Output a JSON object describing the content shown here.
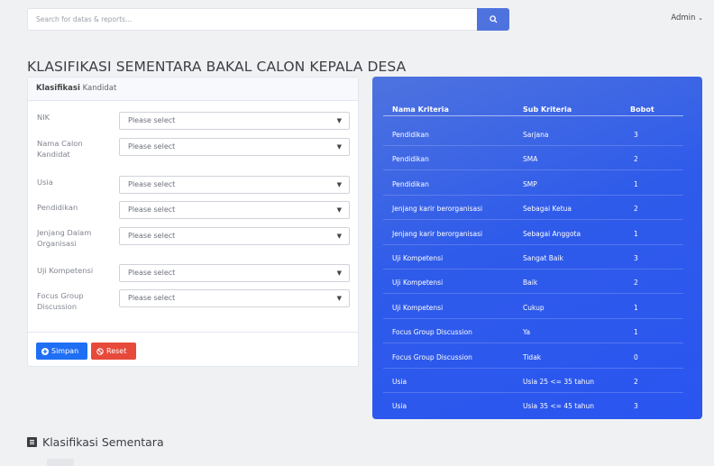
{
  "search": {
    "placeholder": "Search for datas & reports..."
  },
  "user": {
    "name": "Admin",
    "caret": "⌄"
  },
  "page": {
    "title": "KLASIFIKASI SEMENTARA BAKAL CALON KEPALA DESA"
  },
  "form": {
    "header_bold": "Klasifikasi",
    "header_rest": " Kandidat",
    "select_placeholder": "Please select",
    "fields": [
      {
        "label": "NIK"
      },
      {
        "label": "Nama Calon Kandidat"
      },
      {
        "label": "Usia"
      },
      {
        "label": "Pendidikan"
      },
      {
        "label": "Jenjang Dalam Organisasi"
      },
      {
        "label": "Uji Kompetensi"
      },
      {
        "label": "Focus Group Discussion"
      }
    ],
    "save_label": "Simpan",
    "reset_label": "Reset"
  },
  "criteria_table": {
    "columns": [
      "Nama Kriteria",
      "Sub Kriteria",
      "Bobot"
    ],
    "rows": [
      [
        "Pendidikan",
        "Sarjana",
        "3"
      ],
      [
        "Pendidikan",
        "SMA",
        "2"
      ],
      [
        "Pendidikan",
        "SMP",
        "1"
      ],
      [
        "Jenjang karir berorganisasi",
        "Sebagai Ketua",
        "2"
      ],
      [
        "Jenjang karir berorganisasi",
        "Sebagai Anggota",
        "1"
      ],
      [
        "Uji Kompetensi",
        "Sangat Baik",
        "3"
      ],
      [
        "Uji Kompetensi",
        "Baik",
        "2"
      ],
      [
        "Uji Kompetensi",
        "Cukup",
        "1"
      ],
      [
        "Focus Group Discussion",
        "Ya",
        "1"
      ],
      [
        "Focus Group Discussion",
        "Tidak",
        "0"
      ],
      [
        "Usia",
        "Usia 25 <= 35 tahun",
        "2"
      ],
      [
        "Usia",
        "Usia 35 <= 45 tahun",
        "3"
      ]
    ]
  },
  "section": {
    "title": "Klasifikasi Sementara"
  },
  "colors": {
    "accent": "#4e73df",
    "panel_blue": "#2f5bea",
    "danger": "#e74a3b",
    "primary": "#1f6ff5"
  }
}
